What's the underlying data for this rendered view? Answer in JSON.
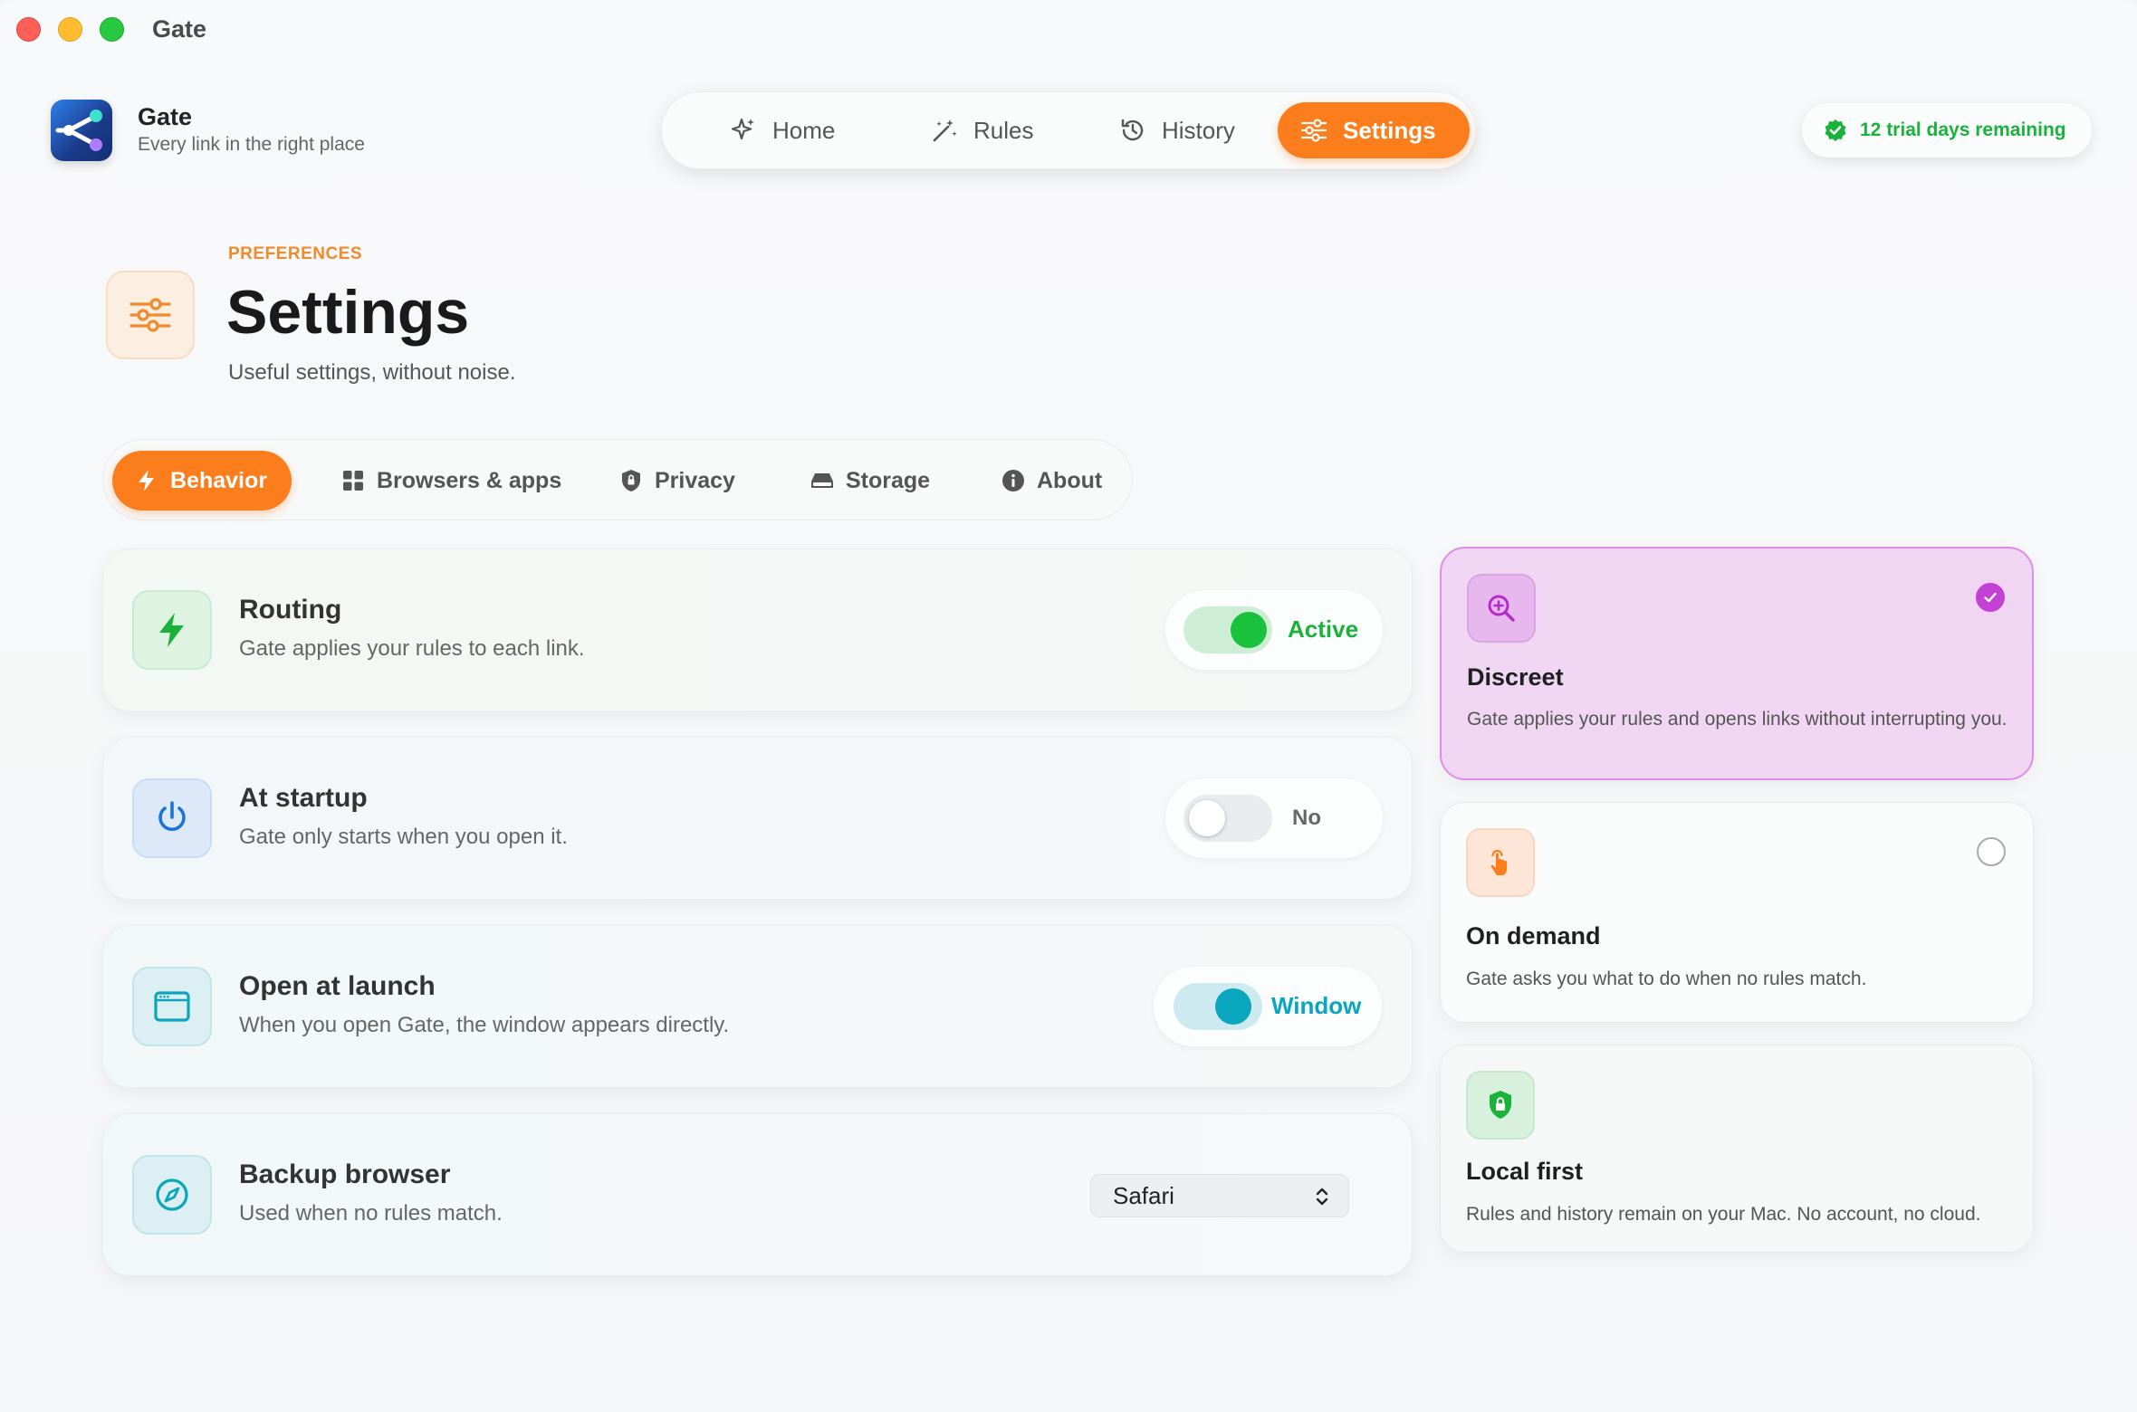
{
  "window": {
    "title": "Gate"
  },
  "brand": {
    "name": "Gate",
    "tagline": "Every link in the right place"
  },
  "nav": {
    "items": [
      {
        "label": "Home",
        "icon": "sparkles-icon"
      },
      {
        "label": "Rules",
        "icon": "magic-wand-icon"
      },
      {
        "label": "History",
        "icon": "history-icon"
      },
      {
        "label": "Settings",
        "icon": "sliders-icon",
        "active": true
      }
    ]
  },
  "trial": {
    "label": "12 trial days remaining",
    "color": "#19b23b"
  },
  "page": {
    "eyebrow": "PREFERENCES",
    "title": "Settings",
    "subtitle": "Useful settings, without noise."
  },
  "subtabs": [
    {
      "label": "Behavior",
      "icon": "bolt-icon",
      "active": true
    },
    {
      "label": "Browsers & apps",
      "icon": "grid-icon"
    },
    {
      "label": "Privacy",
      "icon": "shield-icon"
    },
    {
      "label": "Storage",
      "icon": "drive-icon"
    },
    {
      "label": "About",
      "icon": "info-icon"
    }
  ],
  "settings": [
    {
      "title": "Routing",
      "description": "Gate applies your rules to each link.",
      "state": "Active",
      "on": true
    },
    {
      "title": "At startup",
      "description": "Gate only starts when you open it.",
      "state": "No",
      "on": false
    },
    {
      "title": "Open at launch",
      "description": "When you open Gate, the window appears directly.",
      "state": "Window",
      "on": true
    },
    {
      "title": "Backup browser",
      "description": "Used when no rules match.",
      "select_value": "Safari"
    }
  ],
  "modes": [
    {
      "title": "Discreet",
      "description": "Gate applies your rules and opens links without interrupting you.",
      "selected": true
    },
    {
      "title": "On demand",
      "description": "Gate asks you what to do when no rules match.",
      "selected": false
    },
    {
      "title": "Local first",
      "description": "Rules and history remain on your Mac. No account, no cloud."
    }
  ],
  "colors": {
    "accent": "#fb7d1c",
    "active_green": "#19c23a",
    "teal": "#0aa6bd",
    "purple": "#c441d6"
  }
}
